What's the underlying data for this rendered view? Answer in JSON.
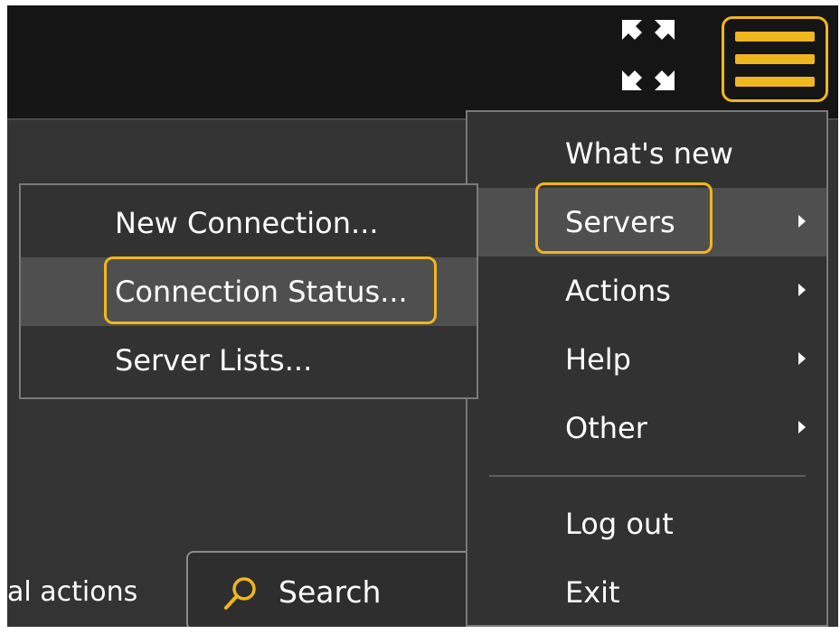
{
  "topbar": {
    "fullscreen_icon": "expand-arrows-icon",
    "menu_icon": "hamburger-menu-icon",
    "accent_color": "#f0b61e"
  },
  "toolbar": {
    "actions_label": "al actions",
    "search_placeholder": "Search",
    "search_icon": "search-icon"
  },
  "main_menu": {
    "items": [
      {
        "label": "What's new",
        "has_submenu": false
      },
      {
        "label": "Servers",
        "has_submenu": true,
        "active": true
      },
      {
        "label": "Actions",
        "has_submenu": true
      },
      {
        "label": "Help",
        "has_submenu": true
      },
      {
        "label": "Other",
        "has_submenu": true
      },
      {
        "label": "Log out",
        "has_submenu": false
      },
      {
        "label": "Exit",
        "has_submenu": false
      }
    ]
  },
  "servers_submenu": {
    "items": [
      {
        "label": "New Connection..."
      },
      {
        "label": "Connection Status...",
        "active": true
      },
      {
        "label": "Server Lists..."
      }
    ]
  }
}
